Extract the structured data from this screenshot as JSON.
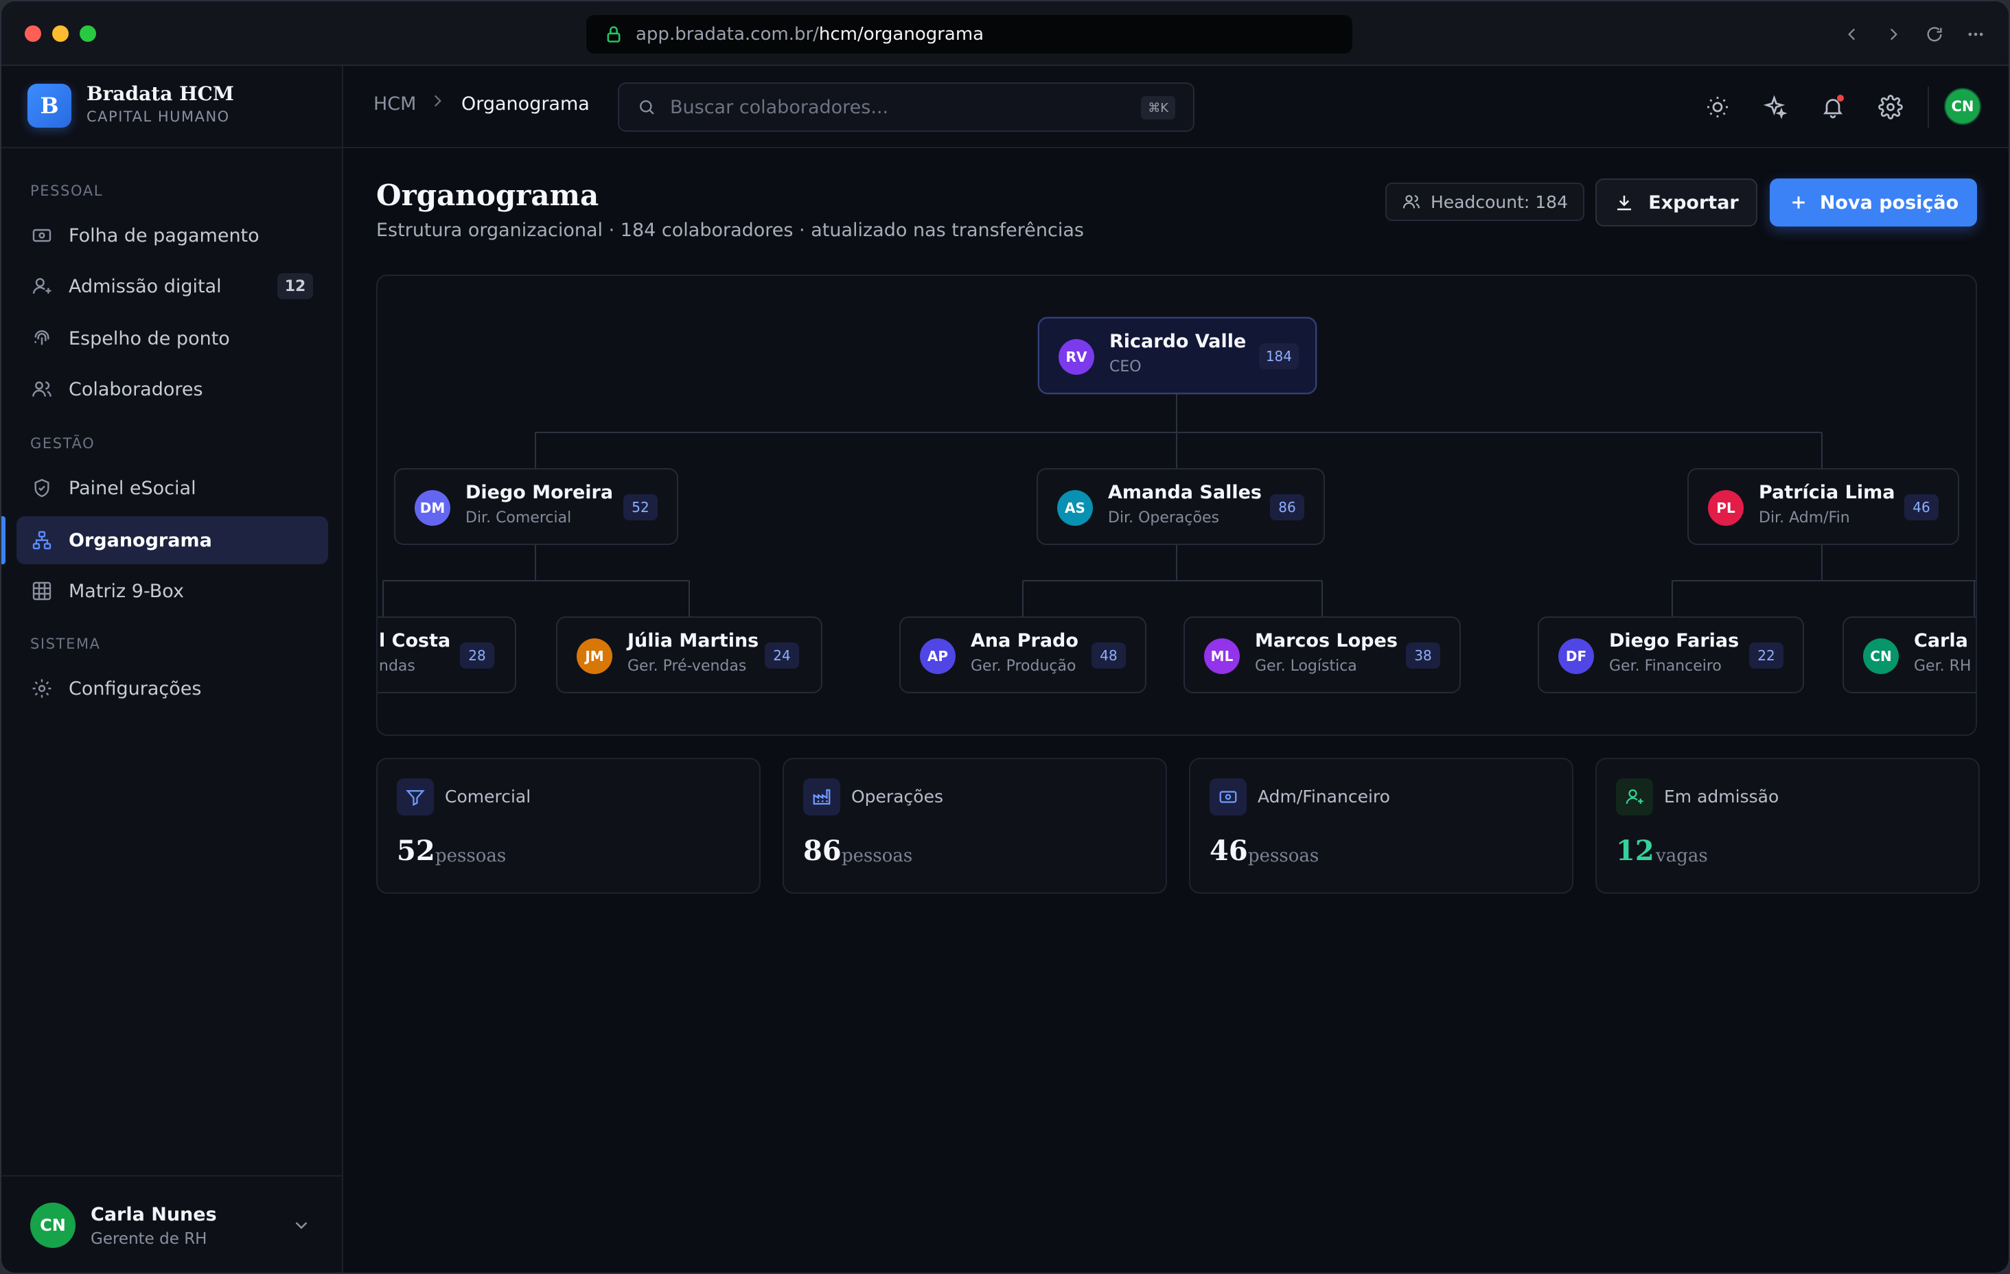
{
  "browser": {
    "url_host": "app.bradata.com.br/",
    "url_path": "hcm/organograma"
  },
  "brand": {
    "logo_letter": "B",
    "name": "Bradata HCM",
    "subtitle": "CAPITAL HUMANO"
  },
  "sidebar": {
    "sections": [
      {
        "label": "PESSOAL"
      },
      {
        "label": "GESTÃO"
      },
      {
        "label": "SISTEMA"
      }
    ],
    "items": [
      {
        "label": "Folha de pagamento",
        "icon": "money-icon"
      },
      {
        "label": "Admissão digital",
        "icon": "user-plus-icon",
        "badge": "12"
      },
      {
        "label": "Espelho de ponto",
        "icon": "fingerprint-icon"
      },
      {
        "label": "Colaboradores",
        "icon": "users-icon"
      },
      {
        "label": "Painel eSocial",
        "icon": "shield-icon"
      },
      {
        "label": "Organograma",
        "icon": "org-chart-icon",
        "active": true
      },
      {
        "label": "Matriz 9-Box",
        "icon": "grid-icon"
      },
      {
        "label": "Configurações",
        "icon": "gear-icon"
      }
    ],
    "user": {
      "initials": "CN",
      "name": "Carla Nunes",
      "role": "Gerente de RH"
    }
  },
  "topbar": {
    "breadcrumb": {
      "home": "HCM",
      "current": "Organograma"
    },
    "search": {
      "placeholder": "Buscar colaboradores...",
      "shortcut": "⌘K"
    },
    "avatar_initials": "CN"
  },
  "page": {
    "title": "Organograma",
    "subtitle": "Estrutura organizacional · 184 colaboradores · atualizado nas transferências",
    "headcount_label": "Headcount: 184",
    "export_label": "Exportar",
    "new_position_label": "Nova posição"
  },
  "org": {
    "ceo": {
      "initials": "RV",
      "name": "Ricardo Valle",
      "role": "CEO",
      "count": "184",
      "color": "#7c3aed"
    },
    "directors": [
      {
        "initials": "DM",
        "name": "Diego Moreira",
        "role": "Dir. Comercial",
        "count": "52",
        "color": "#6366f1"
      },
      {
        "initials": "AS",
        "name": "Amanda Salles",
        "role": "Dir. Operações",
        "count": "86",
        "color": "#0891b2"
      },
      {
        "initials": "PL",
        "name": "Patrícia Lima",
        "role": "Dir. Adm/Fin",
        "count": "46",
        "color": "#e11d48"
      }
    ],
    "managers": [
      {
        "initials": "",
        "name": "l Costa",
        "role": "ndas",
        "count": "28",
        "color": "#6366f1"
      },
      {
        "initials": "JM",
        "name": "Júlia Martins",
        "role": "Ger. Pré-vendas",
        "count": "24",
        "color": "#d97706"
      },
      {
        "initials": "AP",
        "name": "Ana Prado",
        "role": "Ger. Produção",
        "count": "48",
        "color": "#4f46e5"
      },
      {
        "initials": "ML",
        "name": "Marcos Lopes",
        "role": "Ger. Logística",
        "count": "38",
        "color": "#9333ea"
      },
      {
        "initials": "DF",
        "name": "Diego Farias",
        "role": "Ger. Financeiro",
        "count": "22",
        "color": "#4f46e5"
      },
      {
        "initials": "CN",
        "name": "Carla I",
        "role": "Ger. RH",
        "count": "",
        "color": "#059669"
      }
    ]
  },
  "stats": [
    {
      "title": "Comercial",
      "value": "52",
      "unit": "pessoas",
      "icon": "filter-icon"
    },
    {
      "title": "Operações",
      "value": "86",
      "unit": "pessoas",
      "icon": "factory-icon"
    },
    {
      "title": "Adm/Financeiro",
      "value": "46",
      "unit": "pessoas",
      "icon": "money-icon"
    },
    {
      "title": "Em admissão",
      "value": "12",
      "unit": "vagas",
      "icon": "user-plus-icon",
      "accent": "#34d399"
    }
  ]
}
